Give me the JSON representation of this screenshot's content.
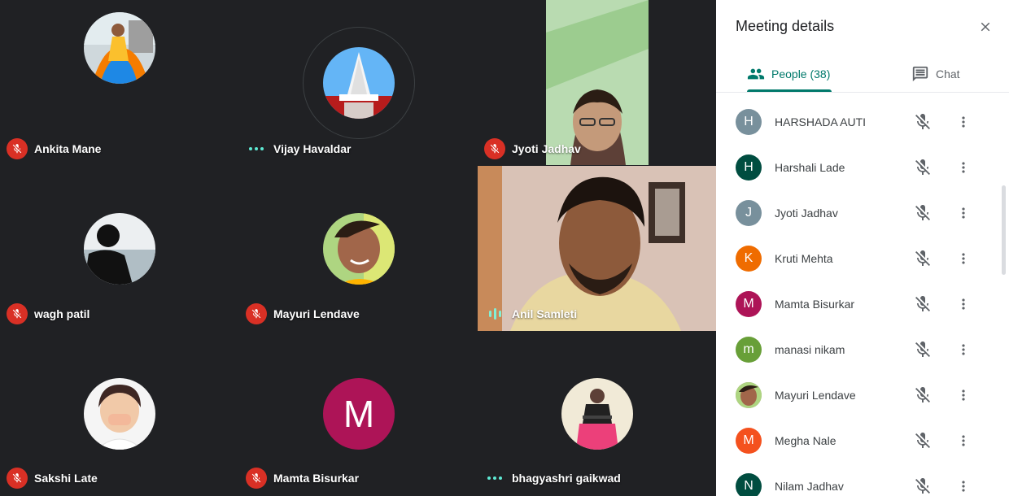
{
  "tiles": [
    {
      "name": "Ankita Mane",
      "status": "muted"
    },
    {
      "name": "Vijay Havaldar",
      "status": "speaking-dots"
    },
    {
      "name": "Jyoti Jadhav",
      "status": "muted"
    },
    {
      "name": "wagh patil",
      "status": "muted"
    },
    {
      "name": "Mayuri Lendave",
      "status": "muted"
    },
    {
      "name": "Anil Samleti",
      "status": "audio-bars"
    },
    {
      "name": "Sakshi Late",
      "status": "muted"
    },
    {
      "name": "Mamta Bisurkar",
      "status": "muted",
      "avatar_letter": "M"
    },
    {
      "name": "bhagyashri gaikwad",
      "status": "speaking-dots"
    }
  ],
  "panel": {
    "title": "Meeting details",
    "tab_people": "People (38)",
    "tab_chat": "Chat"
  },
  "people": [
    {
      "name": "HARSHADA AUTI",
      "letter": "H",
      "color": "#78909c"
    },
    {
      "name": "Harshali Lade",
      "letter": "H",
      "color": "#004d40"
    },
    {
      "name": "Jyoti Jadhav",
      "letter": "J",
      "color": "#78909c"
    },
    {
      "name": "Kruti Mehta",
      "letter": "K",
      "color": "#ef6c00"
    },
    {
      "name": "Mamta Bisurkar",
      "letter": "M",
      "color": "#ad1457"
    },
    {
      "name": "manasi nikam",
      "letter": "m",
      "color": "#689f38"
    },
    {
      "name": "Mayuri Lendave",
      "letter": "",
      "color": "#a1887f"
    },
    {
      "name": "Megha Nale",
      "letter": "M",
      "color": "#f4511e"
    },
    {
      "name": "Nilam Jadhav",
      "letter": "N",
      "color": "#004d40"
    }
  ],
  "colors": {
    "muted_badge": "#d93025",
    "accent": "#00796b",
    "background": "#202124",
    "mamta_avatar": "#ad1457"
  }
}
